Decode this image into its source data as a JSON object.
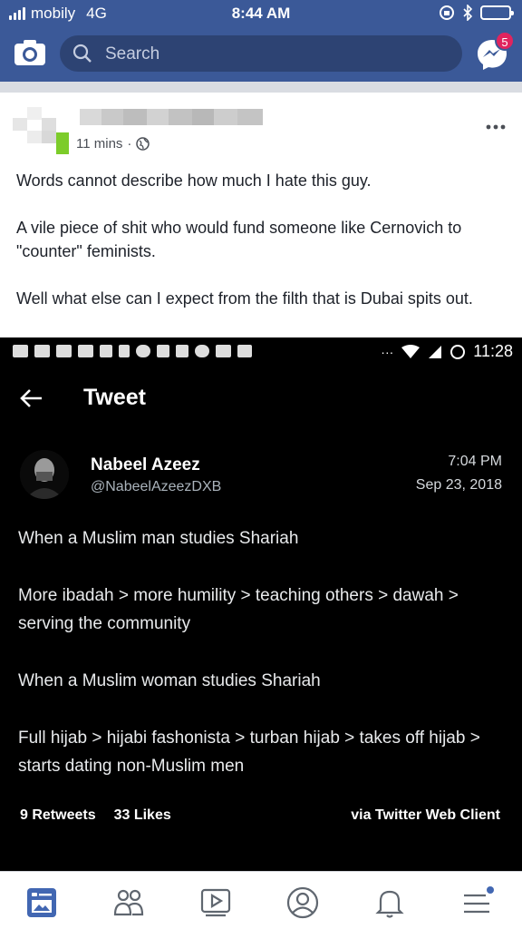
{
  "status_bar": {
    "carrier": "mobily",
    "network": "4G",
    "time": "8:44 AM"
  },
  "header": {
    "search_placeholder": "Search",
    "messenger_badge": "5"
  },
  "post": {
    "timestamp": "11 mins",
    "separator": "·",
    "paragraphs": [
      "Words cannot describe how much I hate this guy.",
      "A vile piece of shit who would fund someone like Cernovich to \"counter\" feminists.",
      "Well what else can I expect from the filth that is Dubai spits out."
    ]
  },
  "screenshot": {
    "android_time": "11:28",
    "android_overflow": "···",
    "tweet_header": "Tweet",
    "author_name": "Nabeel Azeez",
    "author_handle": "@NabeelAzeezDXB",
    "tweet_time": "7:04 PM",
    "tweet_date": "Sep 23, 2018",
    "tweet_paragraphs": [
      "When a Muslim man studies Shariah",
      "More ibadah > more humility > teaching others > dawah > serving the community",
      "When a Muslim woman studies Shariah",
      "Full hijab > hijabi fashonista > turban hijab > takes off hijab > starts dating non-Muslim men"
    ],
    "retweets": "9 Retweets",
    "likes": "33 Likes",
    "via": "via Twitter Web Client"
  },
  "tabs": [
    "news-feed",
    "friends",
    "watch",
    "profile",
    "notifications",
    "menu"
  ],
  "colors": {
    "fb_blue": "#3b5998",
    "badge_red": "#e0245e",
    "active_tab": "#4267b2"
  }
}
